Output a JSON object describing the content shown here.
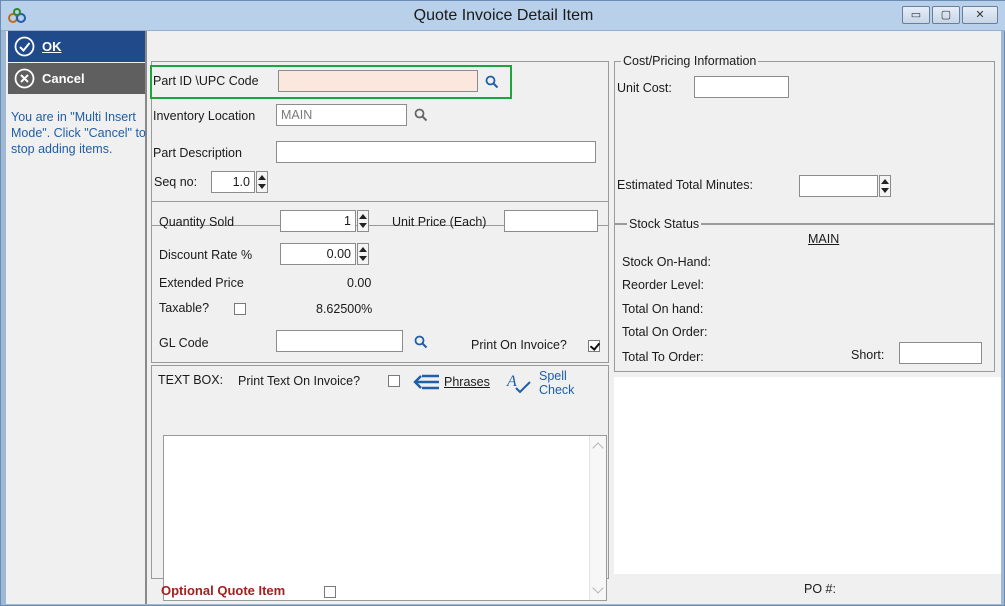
{
  "window": {
    "title": "Quote Invoice Detail Item",
    "min": "▭",
    "max": "▢",
    "close": "✕"
  },
  "sidebar": {
    "ok_label": "OK",
    "cancel_label": "Cancel",
    "note": "You are in \"Multi Insert Mode\". Click \"Cancel\" to stop adding items."
  },
  "part": {
    "part_id_label": "Part ID \\UPC Code",
    "part_id_value": "",
    "location_label": "Inventory Location",
    "location_value": "MAIN",
    "description_label": "Part Description",
    "description_value": "",
    "seq_label": "Seq no:",
    "seq_value": "1.0"
  },
  "pricing": {
    "quantity_label": "Quantity Sold",
    "quantity_value": "1",
    "unit_price_label": "Unit Price (Each)",
    "unit_price_value": "",
    "discount_label": "Discount Rate %",
    "discount_value": "0.00",
    "extended_label": "Extended Price",
    "extended_value": "0.00",
    "taxable_label": "Taxable?",
    "tax_rate": "8.62500%",
    "gl_label": "GL Code",
    "gl_value": "",
    "print_on_invoice_label": "Print On Invoice?"
  },
  "textbox": {
    "label": "TEXT BOX:",
    "print_text_label": "Print Text On Invoice?",
    "phrases_label": "Phrases",
    "spell_label": "Spell",
    "check_label": "Check"
  },
  "cost": {
    "legend": "Cost/Pricing Information",
    "unit_cost_label": "Unit Cost:",
    "unit_cost_value": "",
    "est_minutes_label": "Estimated Total Minutes:",
    "est_minutes_value": ""
  },
  "stock": {
    "legend": "Stock Status",
    "location": "MAIN",
    "on_hand_label": "Stock On-Hand:",
    "reorder_label": "Reorder Level:",
    "total_on_hand_label": "Total On hand:",
    "total_on_order_label": "Total On Order:",
    "total_to_order_label": "Total To Order:",
    "short_label": "Short:",
    "short_value": ""
  },
  "footer": {
    "optional_label": "Optional Quote Item",
    "po_label": "PO #:"
  },
  "colors": {
    "accent": "#214a8a",
    "highlight": "#1da53c",
    "note": "#1f5ea8",
    "optional": "#a12020"
  }
}
